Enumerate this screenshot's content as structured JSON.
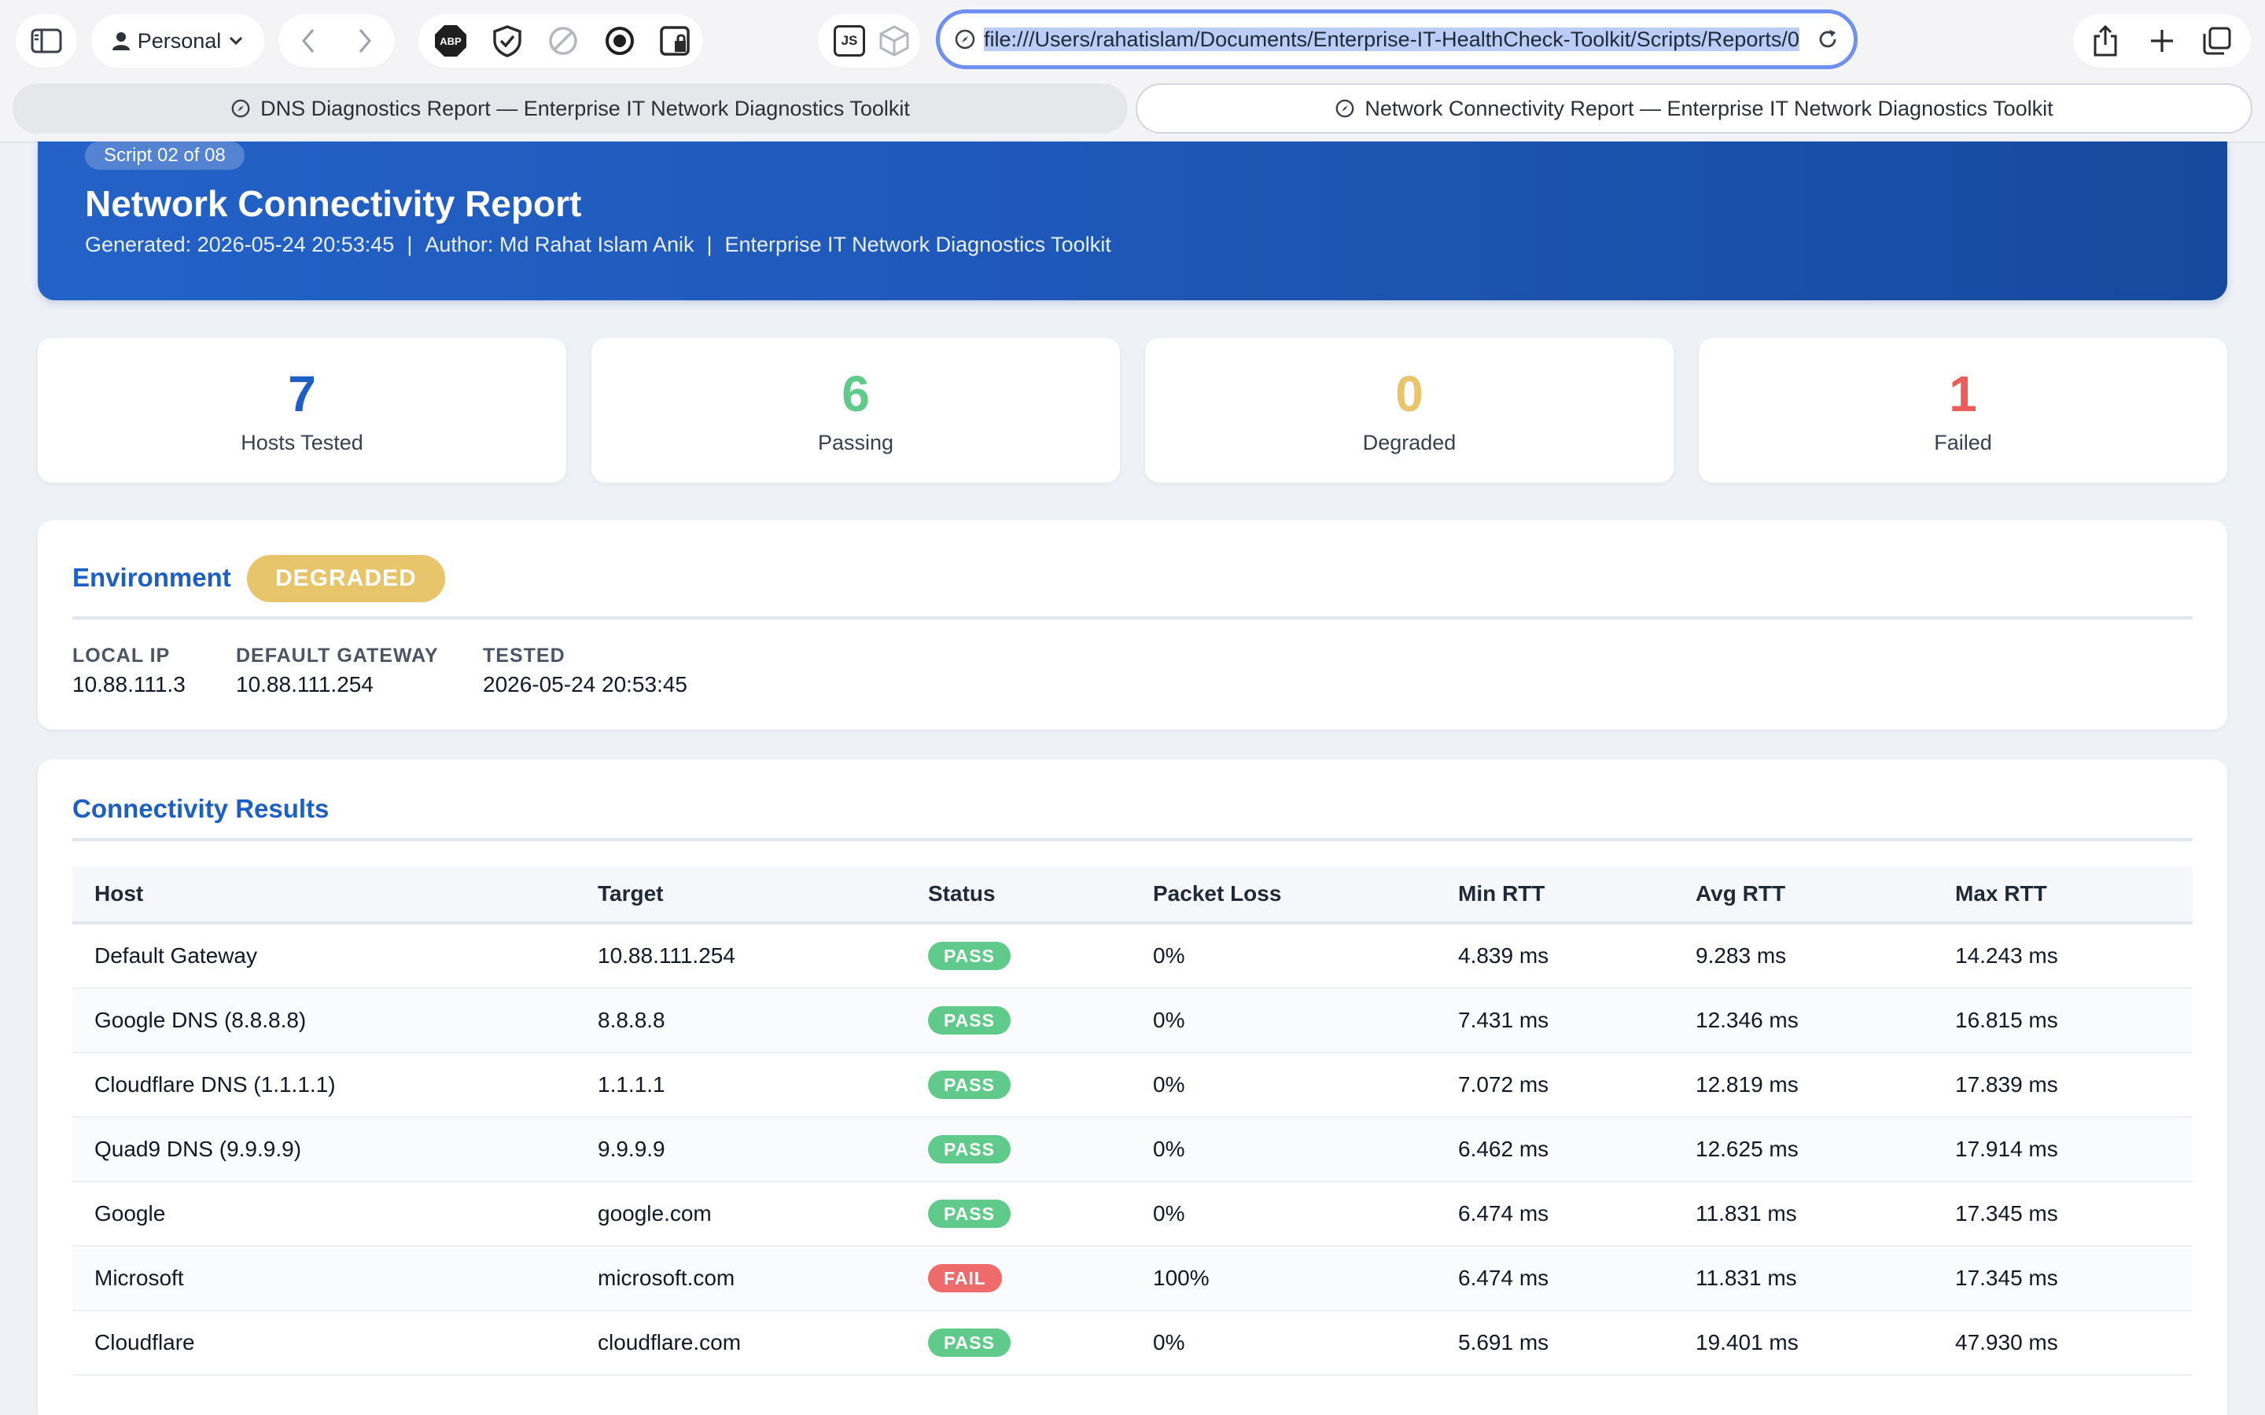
{
  "browser": {
    "profile": "Personal",
    "url": "file:///Users/rahatislam/Documents/Enterprise-IT-HealthCheck-Toolkit/Scripts/Reports/0",
    "extensions": [
      "adblock-icon",
      "vpn-icon",
      "blocked-icon",
      "record-icon",
      "lock-icon"
    ],
    "toolbar_js_label": "JS",
    "tabs": [
      {
        "title": "DNS Diagnostics Report — Enterprise IT Network Diagnostics Toolkit",
        "active": false
      },
      {
        "title": "Network Connectivity Report — Enterprise IT Network Diagnostics Toolkit",
        "active": true
      }
    ]
  },
  "hero": {
    "badge": "Script 02 of 08",
    "title": "Network Connectivity Report",
    "generated": "Generated: 2026-05-24 20:53:45",
    "author": "Author: Md Rahat Islam Anik",
    "toolkit": "Enterprise IT Network Diagnostics Toolkit",
    "separator": "|"
  },
  "stats": [
    {
      "value": "7",
      "label": "Hosts Tested",
      "color": "#1e5fc6"
    },
    {
      "value": "6",
      "label": "Passing",
      "color": "#5fca8a"
    },
    {
      "value": "0",
      "label": "Degraded",
      "color": "#e8c46a"
    },
    {
      "value": "1",
      "label": "Failed",
      "color": "#ef5b5b"
    }
  ],
  "environment": {
    "title": "Environment",
    "status": "DEGRADED",
    "status_color": "#e8c46a",
    "fields": [
      {
        "label": "LOCAL IP",
        "value": "10.88.111.3"
      },
      {
        "label": "DEFAULT GATEWAY",
        "value": "10.88.111.254"
      },
      {
        "label": "TESTED",
        "value": "2026-05-24 20:53:45"
      }
    ]
  },
  "results": {
    "title": "Connectivity Results",
    "columns": [
      "Host",
      "Target",
      "Status",
      "Packet Loss",
      "Min RTT",
      "Avg RTT",
      "Max RTT"
    ],
    "rows": [
      [
        "Default Gateway",
        "10.88.111.254",
        "PASS",
        "0%",
        "4.839 ms",
        "9.283 ms",
        "14.243 ms"
      ],
      [
        "Google DNS (8.8.8.8)",
        "8.8.8.8",
        "PASS",
        "0%",
        "7.431 ms",
        "12.346 ms",
        "16.815 ms"
      ],
      [
        "Cloudflare DNS (1.1.1.1)",
        "1.1.1.1",
        "PASS",
        "0%",
        "7.072 ms",
        "12.819 ms",
        "17.839 ms"
      ],
      [
        "Quad9 DNS (9.9.9.9)",
        "9.9.9.9",
        "PASS",
        "0%",
        "6.462 ms",
        "12.625 ms",
        "17.914 ms"
      ],
      [
        "Google",
        "google.com",
        "PASS",
        "0%",
        "6.474 ms",
        "11.831 ms",
        "17.345 ms"
      ],
      [
        "Microsoft",
        "microsoft.com",
        "FAIL",
        "100%",
        "6.474 ms",
        "11.831 ms",
        "17.345 ms"
      ],
      [
        "Cloudflare",
        "cloudflare.com",
        "PASS",
        "0%",
        "5.691 ms",
        "19.401 ms",
        "47.930 ms"
      ]
    ]
  }
}
